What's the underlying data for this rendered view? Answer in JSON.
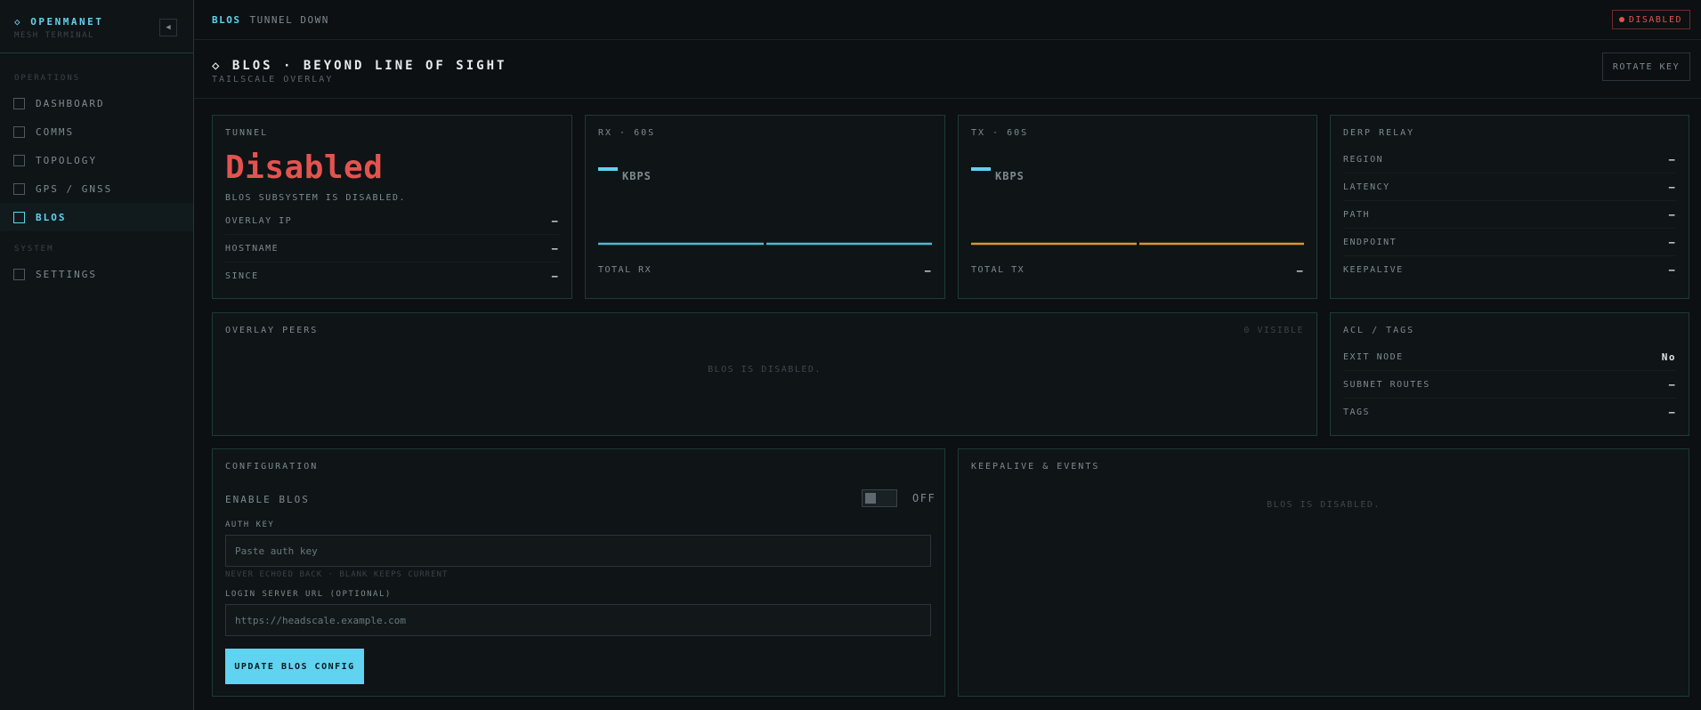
{
  "sidebar": {
    "brand_title": "◇ OPENMANET",
    "brand_sub": "MESH TERMINAL",
    "collapse_glyph": "◀",
    "operations_label": "OPERATIONS",
    "system_label": "SYSTEM",
    "items": [
      {
        "label": "DASHBOARD"
      },
      {
        "label": "COMMS"
      },
      {
        "label": "TOPOLOGY"
      },
      {
        "label": "GPS / GNSS"
      },
      {
        "label": "BLOS"
      },
      {
        "label": "SETTINGS"
      }
    ],
    "active_item": "BLOS"
  },
  "topbar": {
    "crumb_primary": "BLOS",
    "crumb_secondary": "TUNNEL DOWN",
    "status": "DISABLED"
  },
  "header": {
    "title": "◇ BLOS · BEYOND LINE OF SIGHT",
    "subtitle": "TAILSCALE OVERLAY",
    "rotate_key": "ROTATE KEY"
  },
  "tunnel": {
    "title": "TUNNEL",
    "state": "Disabled",
    "message": "BLOS SUBSYSTEM IS DISABLED.",
    "rows": [
      {
        "label": "OVERLAY IP",
        "value": "—"
      },
      {
        "label": "HOSTNAME",
        "value": "—"
      },
      {
        "label": "SINCE",
        "value": "—"
      }
    ]
  },
  "rx": {
    "title": "RX · 60S",
    "unit": "KBPS",
    "total_label": "TOTAL RX",
    "total_value": "—"
  },
  "tx": {
    "title": "TX · 60S",
    "unit": "KBPS",
    "total_label": "TOTAL TX",
    "total_value": "—"
  },
  "derp": {
    "title": "DERP RELAY",
    "rows": [
      {
        "label": "REGION",
        "value": "—"
      },
      {
        "label": "LATENCY",
        "value": "—"
      },
      {
        "label": "PATH",
        "value": "—"
      },
      {
        "label": "ENDPOINT",
        "value": "—"
      },
      {
        "label": "KEEPALIVE",
        "value": "—"
      }
    ]
  },
  "peers": {
    "title": "OVERLAY PEERS",
    "visible": "0 VISIBLE",
    "empty": "BLOS IS DISABLED."
  },
  "acl": {
    "title": "ACL / TAGS",
    "rows": [
      {
        "label": "EXIT NODE",
        "value": "No"
      },
      {
        "label": "SUBNET ROUTES",
        "value": "—"
      },
      {
        "label": "TAGS",
        "value": "—"
      }
    ]
  },
  "config": {
    "title": "CONFIGURATION",
    "enable_label": "ENABLE BLOS",
    "toggle_state": "OFF",
    "auth_key_label": "AUTH KEY",
    "auth_key_placeholder": "Paste auth key",
    "auth_key_hint": "NEVER ECHOED BACK · BLANK KEEPS CURRENT",
    "login_label": "LOGIN SERVER URL (OPTIONAL)",
    "login_placeholder": "https://headscale.example.com",
    "submit": "UPDATE BLOS CONFIG"
  },
  "events": {
    "title": "KEEPALIVE & EVENTS",
    "empty": "BLOS IS DISABLED."
  },
  "colors": {
    "accent": "#5fd3f0",
    "danger": "#e4534f",
    "rx_line": "#4fb8d4",
    "tx_line": "#d9962e",
    "panel_border": "#1d3b33"
  },
  "icons": {
    "nav_item": "square-outline-icon",
    "status": "dot-icon",
    "collapse": "chevron-left-icon"
  }
}
